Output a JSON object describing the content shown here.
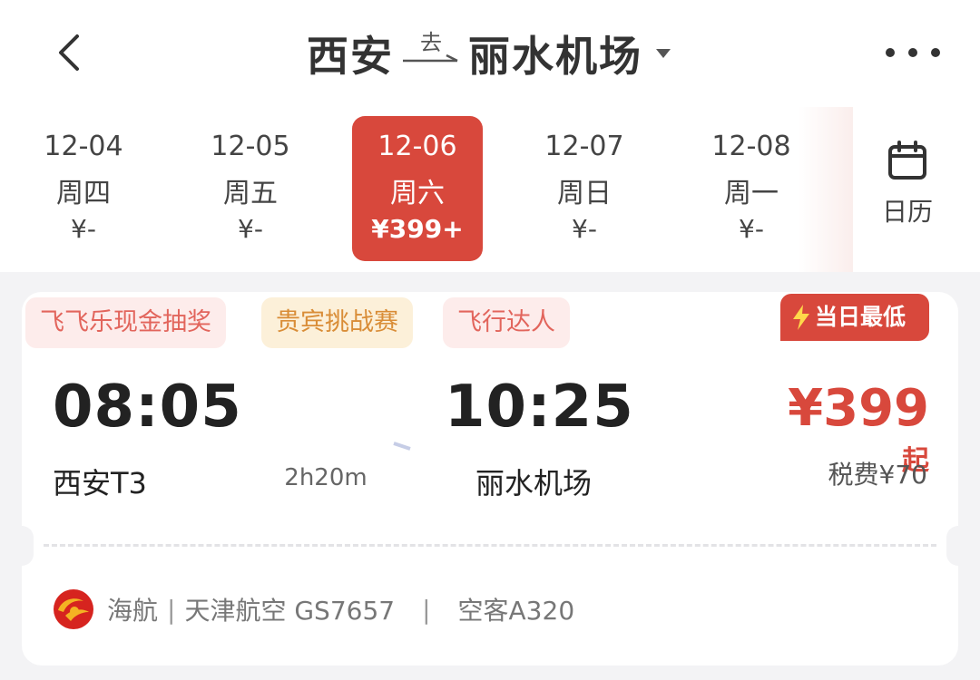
{
  "header": {
    "origin": "西安",
    "go_label": "去",
    "destination": "丽水机场"
  },
  "dates": [
    {
      "date": "12-04",
      "weekday": "周四",
      "price": "¥-",
      "active": false
    },
    {
      "date": "12-05",
      "weekday": "周五",
      "price": "¥-",
      "active": false
    },
    {
      "date": "12-06",
      "weekday": "周六",
      "price": "¥399+",
      "active": true
    },
    {
      "date": "12-07",
      "weekday": "周日",
      "price": "¥-",
      "active": false
    },
    {
      "date": "12-08",
      "weekday": "周一",
      "price": "¥-",
      "active": false
    }
  ],
  "calendar_label": "日历",
  "flight": {
    "tags": [
      "飞飞乐现金抽奖",
      "贵宾挑战赛",
      "飞行达人"
    ],
    "badge": "当日最低",
    "dep_time": "08:05",
    "arr_time": "10:25",
    "dep_airport": "西安T3",
    "arr_airport": "丽水机场",
    "duration": "2h20m",
    "price": "¥399",
    "price_suffix": "起",
    "tax": "税费¥70",
    "airline": "海航",
    "operator": "天津航空 GS7657",
    "aircraft": "空客A320"
  },
  "colors": {
    "accent": "#d8483c",
    "tag_red_bg": "#fdeceb",
    "tag_orange_bg": "#fcf0d9"
  },
  "icons": {
    "back": "chevron-left-icon",
    "caret": "caret-down-icon",
    "more": "more-dots-icon",
    "calendar": "calendar-icon",
    "bolt": "lightning-icon",
    "airline_logo": "hainan-airlines-logo"
  }
}
